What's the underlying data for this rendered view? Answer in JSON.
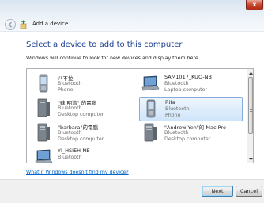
{
  "window": {
    "title": "Add a device",
    "close_glyph": "x"
  },
  "content": {
    "heading": "Select a device to add to this computer",
    "info": "Windows will continue to look for new devices and display them here."
  },
  "devices": [
    {
      "name": "八不拉",
      "connection": "Bluetooth",
      "category": "Phone",
      "icon": "phone-icon",
      "selected": false
    },
    {
      "name": "SAM1017_KUO-NB",
      "connection": "Bluetooth",
      "category": "Laptop computer",
      "icon": "laptop-icon",
      "selected": false
    },
    {
      "name": "\"蘇 明清\" 的電腦",
      "connection": "Bluetooth",
      "category": "Desktop computer",
      "icon": "desktop-icon",
      "selected": false
    },
    {
      "name": "Rita",
      "connection": "Bluetooth",
      "category": "Phone",
      "icon": "phone-icon",
      "selected": true
    },
    {
      "name": "\"barbara\"的電腦",
      "connection": "Bluetooth",
      "category": "Desktop computer",
      "icon": "desktop-icon",
      "selected": false
    },
    {
      "name": "\"Andrew Yeh\"的 Mac Pro",
      "connection": "Bluetooth",
      "category": "Desktop computer",
      "icon": "desktop-icon",
      "selected": false
    },
    {
      "name": "YI_HSIEH-NB",
      "connection": "Bluetooth",
      "category": "",
      "icon": "laptop-icon",
      "selected": false
    }
  ],
  "help_link": "What if Windows doesn't find my device?",
  "buttons": {
    "next": "Next",
    "cancel": "Cancel"
  },
  "colors": {
    "heading": "#1a3e91",
    "link": "#0066cc",
    "selection": "#cfe5fa",
    "close_button": "#c7472e"
  }
}
